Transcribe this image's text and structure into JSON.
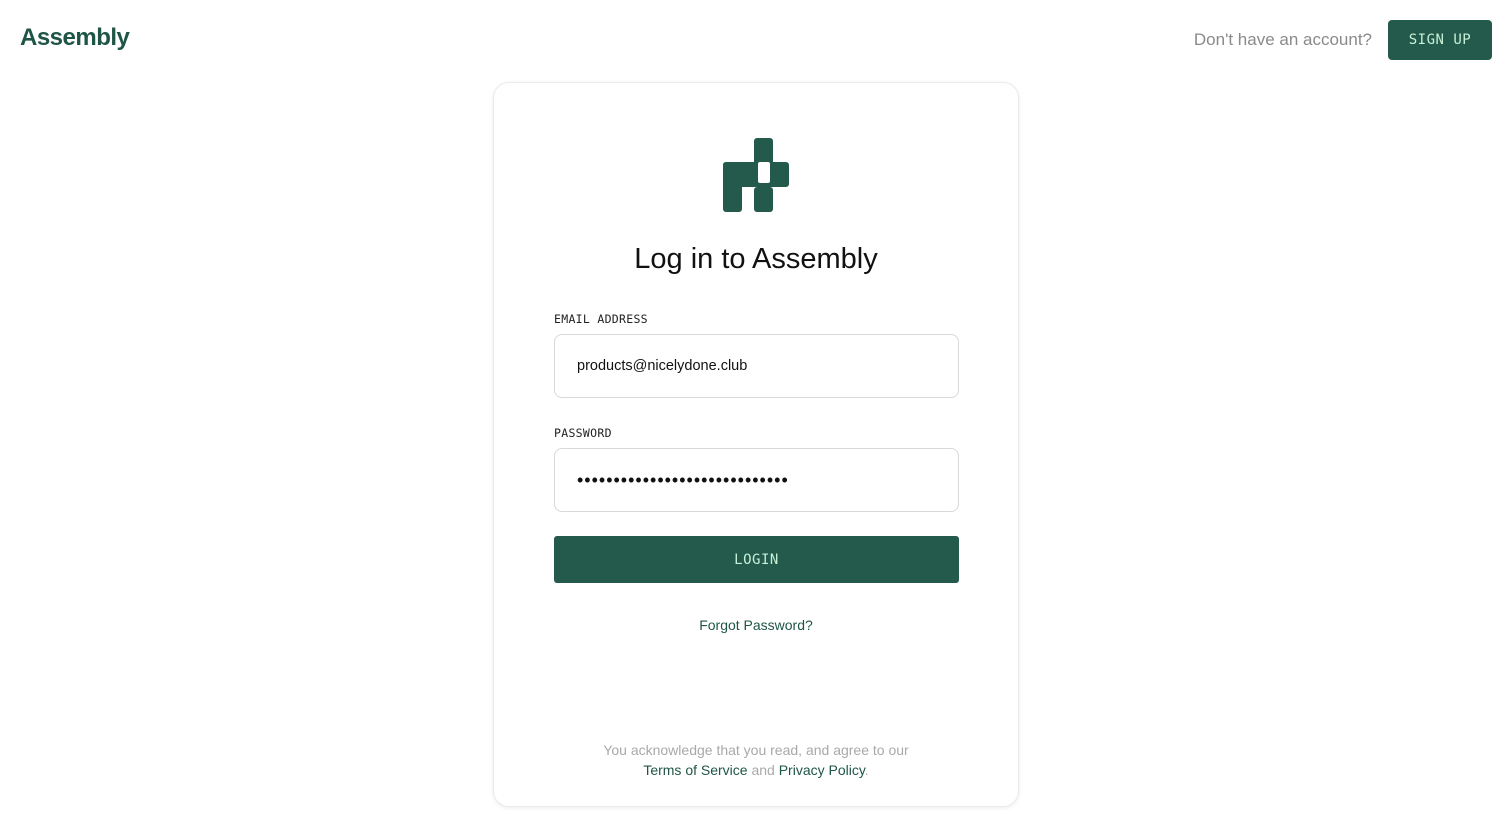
{
  "header": {
    "brand": "Assembly",
    "prompt_text": "Don't have an account?",
    "signup_label": "SIGN UP"
  },
  "card": {
    "logo_icon": "assembly-logo-icon",
    "title": "Log in to Assembly",
    "email": {
      "label": "EMAIL ADDRESS",
      "value": "products@nicelydone.club"
    },
    "password": {
      "label": "PASSWORD",
      "value": "•••••••••••••••••••••••••••••"
    },
    "login_label": "LOGIN",
    "forgot_label": "Forgot Password?",
    "legal": {
      "line1": "You acknowledge that you read, and agree to our",
      "terms": "Terms of Service",
      "and": "and",
      "privacy": "Privacy Policy",
      "end": "."
    }
  },
  "colors": {
    "brand_green": "#245a4b",
    "button_text": "#c6f0d8",
    "muted_text": "#8a8a8a"
  }
}
